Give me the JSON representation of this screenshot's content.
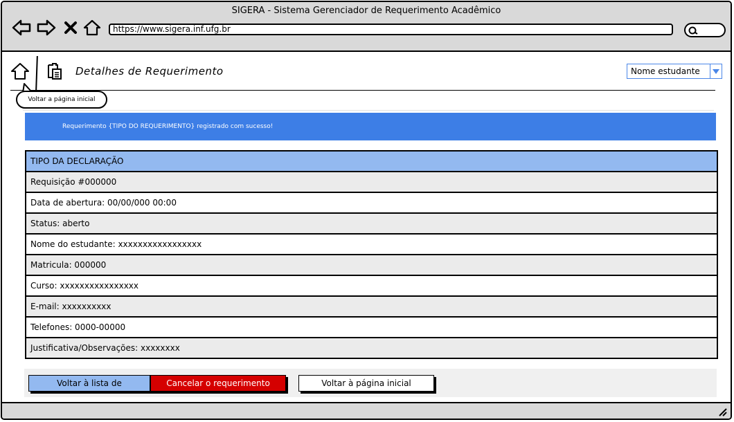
{
  "browser": {
    "window_title": "SIGERA - Sistema Gerenciador de Requerimento Acadêmico",
    "url": "https://www.sigera.inf.ufg.br",
    "icons": [
      "back-arrow-icon",
      "forward-arrow-icon",
      "close-x-icon",
      "home-icon",
      "search-icon"
    ]
  },
  "header": {
    "title": "Detalhes de Requerimento",
    "home_tooltip": "Voltar a página inicial",
    "student_select": {
      "selected": "Nome estudante"
    }
  },
  "banner": {
    "message": "Requerimento {TIPO DO REQUERIMENTO} registrado com sucesso!"
  },
  "details": {
    "header": "TIPO DA DECLARAÇÃO",
    "rows": [
      "Requisição #000000",
      "Data de abertura: 00/00/000 00:00",
      "Status: aberto",
      "Nome do estudante: xxxxxxxxxxxxxxxxx",
      "Matricula: 000000",
      "Curso: xxxxxxxxxxxxxxxx",
      "E-mail: xxxxxxxxxx",
      "Telefones: 0000-00000",
      "Justificativa/Observações: xxxxxxxx"
    ]
  },
  "actions": {
    "back_to_list": "Voltar à lista de",
    "cancel_request": "Cancelar o requerimento",
    "back_to_home": "Voltar à página inicial"
  },
  "colors": {
    "banner": "#3d7ee6",
    "table_header": "#93b9f0",
    "cancel": "#d50000",
    "select_accent": "#4a86e8"
  }
}
